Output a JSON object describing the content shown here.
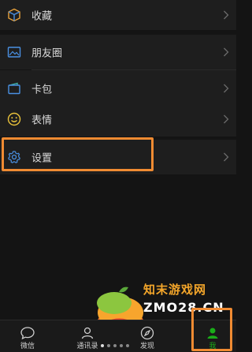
{
  "menu": {
    "items": [
      {
        "label": "收藏",
        "icon": "favorites-cube-icon"
      },
      {
        "label": "朋友圈",
        "icon": "moments-picture-icon"
      },
      {
        "label": "卡包",
        "icon": "card-wallet-icon"
      },
      {
        "label": "表情",
        "icon": "sticker-smiley-icon"
      },
      {
        "label": "设置",
        "icon": "settings-gear-icon"
      }
    ]
  },
  "tabbar": {
    "tabs": [
      {
        "label": "微信",
        "icon": "chat-bubble-icon"
      },
      {
        "label": "通讯录",
        "icon": "contacts-icon"
      },
      {
        "label": "发现",
        "icon": "discover-compass-icon"
      },
      {
        "label": "我",
        "icon": "me-person-icon"
      }
    ],
    "active_index": 3
  },
  "watermark": {
    "line1": "知末游戏网",
    "line2": "ZMO28.CN"
  },
  "colors": {
    "background": "#141414",
    "row": "#1e1e1e",
    "highlight": "#f08b32",
    "active_tab": "#1aad19"
  }
}
